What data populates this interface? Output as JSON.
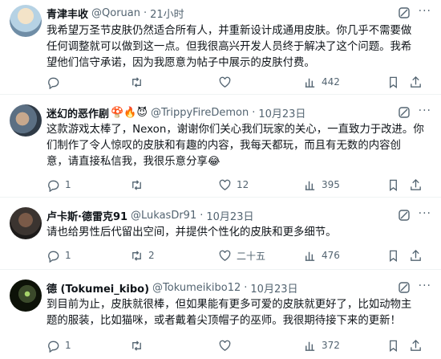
{
  "tweets": [
    {
      "name": "青津丰收",
      "handle": "@Qoruan",
      "time": "21小时",
      "emoji": "",
      "lines": [
        "我希望万圣节皮肤仍然适合所有人，并重新设计成通用皮肤。你几乎不需要做",
        "任何调整就可以做到这一点。但我很高兴开发人员终于解决了这个问题。我希",
        "望他们信守承诺，因为我愿意为帖子中展示的皮肤付费。"
      ],
      "reply": "",
      "retweet": "",
      "like": "",
      "views": "442"
    },
    {
      "name": "迷幻的恶作剧",
      "handle": "@TrippyFireDemon",
      "time": "10月23日",
      "emoji": "🍄🔥😈",
      "lines": [
        "这款游戏太棒了，Nexon，谢谢你们关心我们玩家的关心，一直致力于改进。你",
        "们制作了令人惊叹的皮肤和有趣的内容，我每天都玩，而且有无数的内容创",
        "意，请直接私信我，我很乐意分享😂"
      ],
      "reply": "1",
      "retweet": "",
      "like": "12",
      "views": "395"
    },
    {
      "name": "卢卡斯·德雷克91",
      "handle": "@LukasDr91",
      "time": "10月23日",
      "emoji": "",
      "lines": [
        "请也给男性后代留出空间，并提供个性化的皮肤和更多细节。"
      ],
      "reply": "1",
      "retweet": "2",
      "like": "二十五",
      "views": "476"
    },
    {
      "name": "德 (Tokumei_kibo)",
      "handle": "@Tokumeikibo12",
      "time": "10月23日",
      "emoji": "",
      "lines": [
        "到目前为止，皮肤就很棒，但如果能有更多可爱的皮肤就更好了，比如动物主",
        "题的服装，比如猫咪，或者戴着尖顶帽子的巫师。我很期待接下来的更新！"
      ],
      "reply": "1",
      "retweet": "",
      "like": "",
      "views": "372"
    }
  ],
  "colors": {
    "text": "#0f1419",
    "muted": "#536471",
    "divider": "#eff3f4"
  }
}
